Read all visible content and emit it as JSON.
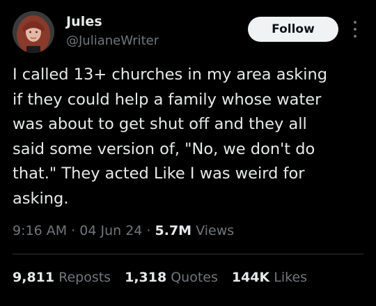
{
  "author": {
    "display_name": "Jules",
    "handle": "@JulianeWriter",
    "follow_label": "Follow",
    "more_icon": "more-vertical-icon"
  },
  "tweet": {
    "text": "I called 13+ churches in my area asking\nif they could help a family whose water\nwas about to get shut off and they all\nsaid some version of, \"No, we don't do\nthat.\" They acted Like I was weird for\nasking."
  },
  "meta": {
    "time": "9:16 AM",
    "separator": "·",
    "date": "04 Jun 24",
    "views_count": "5.7M",
    "views_label": "Views"
  },
  "stats": {
    "reposts_count": "9,811",
    "reposts_label": "Reposts",
    "quotes_count": "1,318",
    "quotes_label": "Quotes",
    "likes_count": "144K",
    "likes_label": "Likes"
  },
  "colors": {
    "background": "#000000",
    "text_primary": "#e7e9ea",
    "text_secondary": "#71767b",
    "follow_button_bg": "#eff3f4",
    "follow_button_text": "#0f1419",
    "divider": "#2f3336"
  }
}
